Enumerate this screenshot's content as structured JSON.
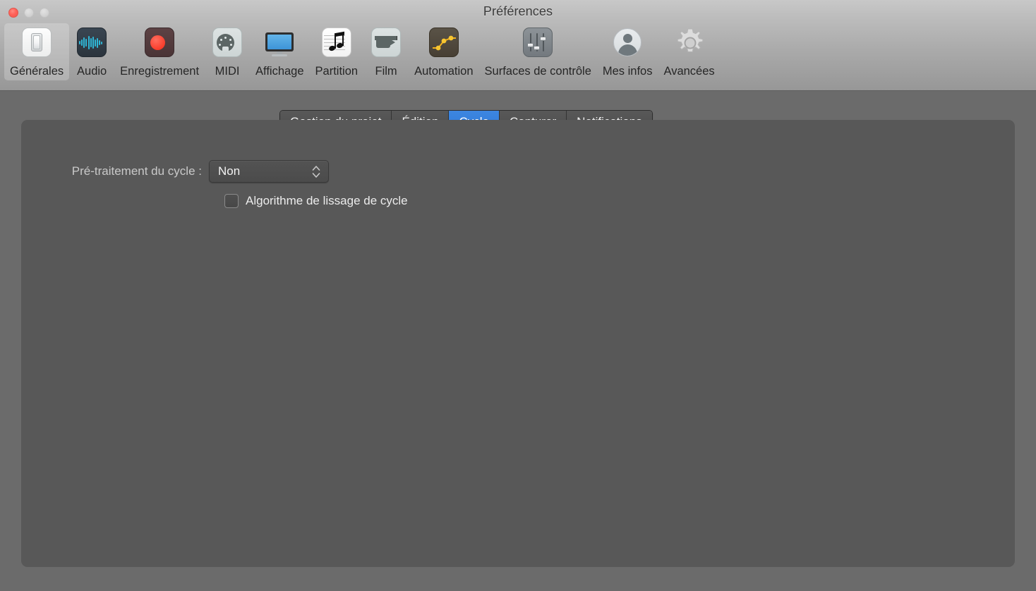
{
  "window": {
    "title": "Préférences",
    "traffic_lights": [
      {
        "name": "close",
        "color": "#ff6259",
        "enabled": true
      },
      {
        "name": "minimize",
        "color": "#d4d4d4",
        "enabled": false
      },
      {
        "name": "zoom",
        "color": "#d4d4d4",
        "enabled": false
      }
    ]
  },
  "toolbar": {
    "selected": "Générales",
    "items": [
      {
        "label": "Générales",
        "icon": "light-switch-icon",
        "selected": true
      },
      {
        "label": "Audio",
        "icon": "waveform-icon",
        "selected": false
      },
      {
        "label": "Enregistrement",
        "icon": "record-dot-icon",
        "selected": false
      },
      {
        "label": "MIDI",
        "icon": "midi-din-connector-icon",
        "selected": false
      },
      {
        "label": "Affichage",
        "icon": "display-monitor-icon",
        "selected": false
      },
      {
        "label": "Partition",
        "icon": "music-score-icon",
        "selected": false
      },
      {
        "label": "Film",
        "icon": "video-camera-icon",
        "selected": false
      },
      {
        "label": "Automation",
        "icon": "automation-curve-icon",
        "selected": false
      },
      {
        "label": "Surfaces de contrôle",
        "icon": "fader-sliders-icon",
        "selected": false
      },
      {
        "label": "Mes infos",
        "icon": "user-avatar-icon",
        "selected": false
      },
      {
        "label": "Avancées",
        "icon": "gear-icon",
        "selected": false
      }
    ]
  },
  "tabs": {
    "active": "Cycle",
    "accent_color": "#2f7ada",
    "items": [
      {
        "label": "Gestion du projet",
        "active": false
      },
      {
        "label": "Édition",
        "active": false
      },
      {
        "label": "Cycle",
        "active": true
      },
      {
        "label": "Capturer",
        "active": false
      },
      {
        "label": "Notifications",
        "active": false
      }
    ]
  },
  "panel": {
    "pretreatment": {
      "label": "Pré-traitement du cycle :",
      "value": "Non",
      "stepper_icon": "up-down-chevron-icon"
    },
    "smoothing": {
      "label": "Algorithme de lissage de cycle",
      "checked": false
    }
  }
}
